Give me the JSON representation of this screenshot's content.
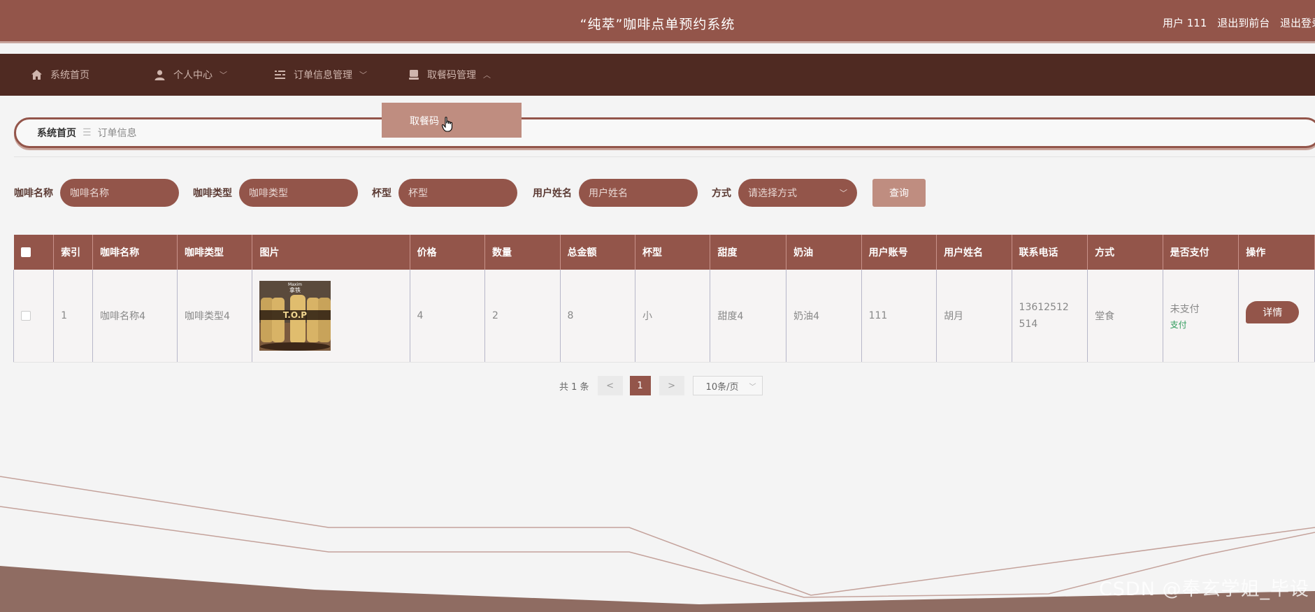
{
  "header": {
    "title": "“纯萃”咖啡点单预约系统",
    "user_label": "用户 111",
    "exit_front": "退出到前台",
    "logout": "退出登录"
  },
  "nav": {
    "items": [
      {
        "label": "系统首页",
        "icon": "home-icon"
      },
      {
        "label": "个人中心",
        "icon": "user-icon"
      },
      {
        "label": "订单信息管理",
        "icon": "list-icon"
      },
      {
        "label": "取餐码管理",
        "icon": "tray-icon"
      }
    ],
    "dropdown_item": "取餐码"
  },
  "breadcrumb": {
    "home": "系统首页",
    "separator": "☰",
    "current": "订单信息"
  },
  "search": {
    "fields": [
      {
        "label": "咖啡名称",
        "placeholder": "咖啡名称"
      },
      {
        "label": "咖啡类型",
        "placeholder": "咖啡类型"
      },
      {
        "label": "杯型",
        "placeholder": "杯型"
      },
      {
        "label": "用户姓名",
        "placeholder": "用户姓名"
      },
      {
        "label": "方式",
        "placeholder": "请选择方式"
      }
    ],
    "query_button": "查询"
  },
  "table": {
    "headers": [
      "索引",
      "咖啡名称",
      "咖啡类型",
      "图片",
      "价格",
      "数量",
      "总金额",
      "杯型",
      "甜度",
      "奶油",
      "用户账号",
      "用户姓名",
      "联系电话",
      "方式",
      "是否支付",
      "操作"
    ],
    "rows": [
      {
        "index": "1",
        "coffee_name": "咖啡名称4",
        "coffee_type": "咖啡类型4",
        "image_text_brand": "Maxim",
        "image_text_sub": "拿铁",
        "image_text_product": "T.O.P",
        "price": "4",
        "quantity": "2",
        "total": "8",
        "cup": "小",
        "sweetness": "甜度4",
        "cream": "奶油4",
        "account": "111",
        "username": "胡月",
        "phone": "13612512514",
        "method": "堂食",
        "paid_status": "未支付",
        "pay_link": "支付",
        "detail_button": "详情"
      }
    ]
  },
  "pagination": {
    "total_text": "共 1 条",
    "prev": "<",
    "current_page": "1",
    "next": ">",
    "page_size": "10条/页"
  },
  "watermark": "CSDN @奉玄学姐_毕设"
}
